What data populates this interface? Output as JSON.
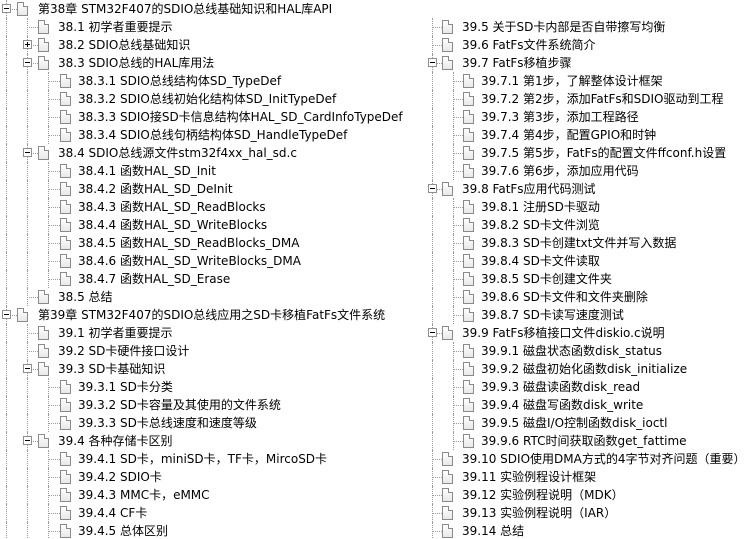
{
  "left": [
    {
      "level": 0,
      "toggle": "minus",
      "label": "第38章 STM32F407的SDIO总线基础知识和HAL库API"
    },
    {
      "level": 1,
      "toggle": null,
      "label": "38.1 初学者重要提示"
    },
    {
      "level": 1,
      "toggle": "plus",
      "label": "38.2 SDIO总线基础知识"
    },
    {
      "level": 1,
      "toggle": "minus",
      "label": "38.3 SDIO总线的HAL库用法"
    },
    {
      "level": 2,
      "toggle": null,
      "label": "38.3.1 SDIO总线结构体SD_TypeDef"
    },
    {
      "level": 2,
      "toggle": null,
      "label": "38.3.2 SDIO总线初始化结构体SD_InitTypeDef"
    },
    {
      "level": 2,
      "toggle": null,
      "label": "38.3.3 SDIO接SD卡信息结构体HAL_SD_CardInfoTypeDef"
    },
    {
      "level": 2,
      "toggle": null,
      "label": "38.3.4 SDIO总线句柄结构体SD_HandleTypeDef"
    },
    {
      "level": 1,
      "toggle": "minus",
      "label": "38.4 SDIO总线源文件stm32f4xx_hal_sd.c"
    },
    {
      "level": 2,
      "toggle": null,
      "label": "38.4.1 函数HAL_SD_Init"
    },
    {
      "level": 2,
      "toggle": null,
      "label": "38.4.2 函数HAL_SD_DeInit"
    },
    {
      "level": 2,
      "toggle": null,
      "label": "38.4.3 函数HAL_SD_ReadBlocks"
    },
    {
      "level": 2,
      "toggle": null,
      "label": "38.4.4 函数HAL_SD_WriteBlocks"
    },
    {
      "level": 2,
      "toggle": null,
      "label": "38.4.5 函数HAL_SD_ReadBlocks_DMA"
    },
    {
      "level": 2,
      "toggle": null,
      "label": "38.4.6 函数HAL_SD_WriteBlocks_DMA"
    },
    {
      "level": 2,
      "toggle": null,
      "label": "38.4.7 函数HAL_SD_Erase"
    },
    {
      "level": 1,
      "toggle": null,
      "label": "38.5 总结"
    },
    {
      "level": 0,
      "toggle": "minus",
      "label": "第39章 STM32F407的SDIO总线应用之SD卡移植FatFs文件系统"
    },
    {
      "level": 1,
      "toggle": null,
      "label": "39.1 初学者重要提示"
    },
    {
      "level": 1,
      "toggle": null,
      "label": "39.2 SD卡硬件接口设计"
    },
    {
      "level": 1,
      "toggle": "minus",
      "label": "39.3 SD卡基础知识"
    },
    {
      "level": 2,
      "toggle": null,
      "label": "39.3.1 SD卡分类"
    },
    {
      "level": 2,
      "toggle": null,
      "label": "39.3.2 SD卡容量及其使用的文件系统"
    },
    {
      "level": 2,
      "toggle": null,
      "label": "39.3.3 SD卡总线速度和速度等级"
    },
    {
      "level": 1,
      "toggle": "minus",
      "label": "39.4 各种存储卡区别"
    },
    {
      "level": 2,
      "toggle": null,
      "label": "39.4.1 SD卡，miniSD卡，TF卡，MircoSD卡"
    },
    {
      "level": 2,
      "toggle": null,
      "label": "39.4.2 SDIO卡"
    },
    {
      "level": 2,
      "toggle": null,
      "label": "39.4.3 MMC卡，eMMC"
    },
    {
      "level": 2,
      "toggle": null,
      "label": "39.4.4 CF卡"
    },
    {
      "level": 2,
      "toggle": null,
      "label": "39.4.5 总体区别"
    }
  ],
  "right": [
    {
      "level": 1,
      "toggle": null,
      "label": "39.5 关于SD卡内部是否自带擦写均衡"
    },
    {
      "level": 1,
      "toggle": null,
      "label": "39.6 FatFs文件系统简介"
    },
    {
      "level": 1,
      "toggle": "minus",
      "label": "39.7 FatFs移植步骤"
    },
    {
      "level": 2,
      "toggle": null,
      "label": "39.7.1 第1步，了解整体设计框架"
    },
    {
      "level": 2,
      "toggle": null,
      "label": "39.7.2 第2步，添加FatFs和SDIO驱动到工程"
    },
    {
      "level": 2,
      "toggle": null,
      "label": "39.7.3 第3步，添加工程路径"
    },
    {
      "level": 2,
      "toggle": null,
      "label": "39.7.4 第4步，配置GPIO和时钟"
    },
    {
      "level": 2,
      "toggle": null,
      "label": "39.7.5 第5步，FatFs的配置文件ffconf.h设置"
    },
    {
      "level": 2,
      "toggle": null,
      "label": "39.7.6 第6步，添加应用代码"
    },
    {
      "level": 1,
      "toggle": "minus",
      "label": "39.8 FatFs应用代码测试"
    },
    {
      "level": 2,
      "toggle": null,
      "label": "39.8.1 注册SD卡驱动"
    },
    {
      "level": 2,
      "toggle": null,
      "label": "39.8.2 SD卡文件浏览"
    },
    {
      "level": 2,
      "toggle": null,
      "label": "39.8.3 SD卡创建txt文件并写入数据"
    },
    {
      "level": 2,
      "toggle": null,
      "label": "39.8.4 SD卡文件读取"
    },
    {
      "level": 2,
      "toggle": null,
      "label": "39.8.5 SD卡创建文件夹"
    },
    {
      "level": 2,
      "toggle": null,
      "label": "39.8.6 SD卡文件和文件夹删除"
    },
    {
      "level": 2,
      "toggle": null,
      "label": "39.8.7 SD卡读写速度测试"
    },
    {
      "level": 1,
      "toggle": "minus",
      "label": "39.9 FatFs移植接口文件diskio.c说明"
    },
    {
      "level": 2,
      "toggle": null,
      "label": "39.9.1 磁盘状态函数disk_status"
    },
    {
      "level": 2,
      "toggle": null,
      "label": "39.9.2 磁盘初始化函数disk_initialize"
    },
    {
      "level": 2,
      "toggle": null,
      "label": "39.9.3 磁盘读函数disk_read"
    },
    {
      "level": 2,
      "toggle": null,
      "label": "39.9.4 磁盘写函数disk_write"
    },
    {
      "level": 2,
      "toggle": null,
      "label": "39.9.5 磁盘I/O控制函数disk_ioctl"
    },
    {
      "level": 2,
      "toggle": null,
      "label": "39.9.6 RTC时间获取函数get_fattime"
    },
    {
      "level": 1,
      "toggle": null,
      "label": "39.10 SDIO使用DMA方式的4字节对齐问题（重要）"
    },
    {
      "level": 1,
      "toggle": null,
      "label": "39.11 实验例程设计框架"
    },
    {
      "level": 1,
      "toggle": null,
      "label": "39.12 实验例程说明（MDK）"
    },
    {
      "level": 1,
      "toggle": null,
      "label": "39.13 实验例程说明（IAR）"
    },
    {
      "level": 1,
      "toggle": null,
      "label": "39.14 总结"
    }
  ]
}
